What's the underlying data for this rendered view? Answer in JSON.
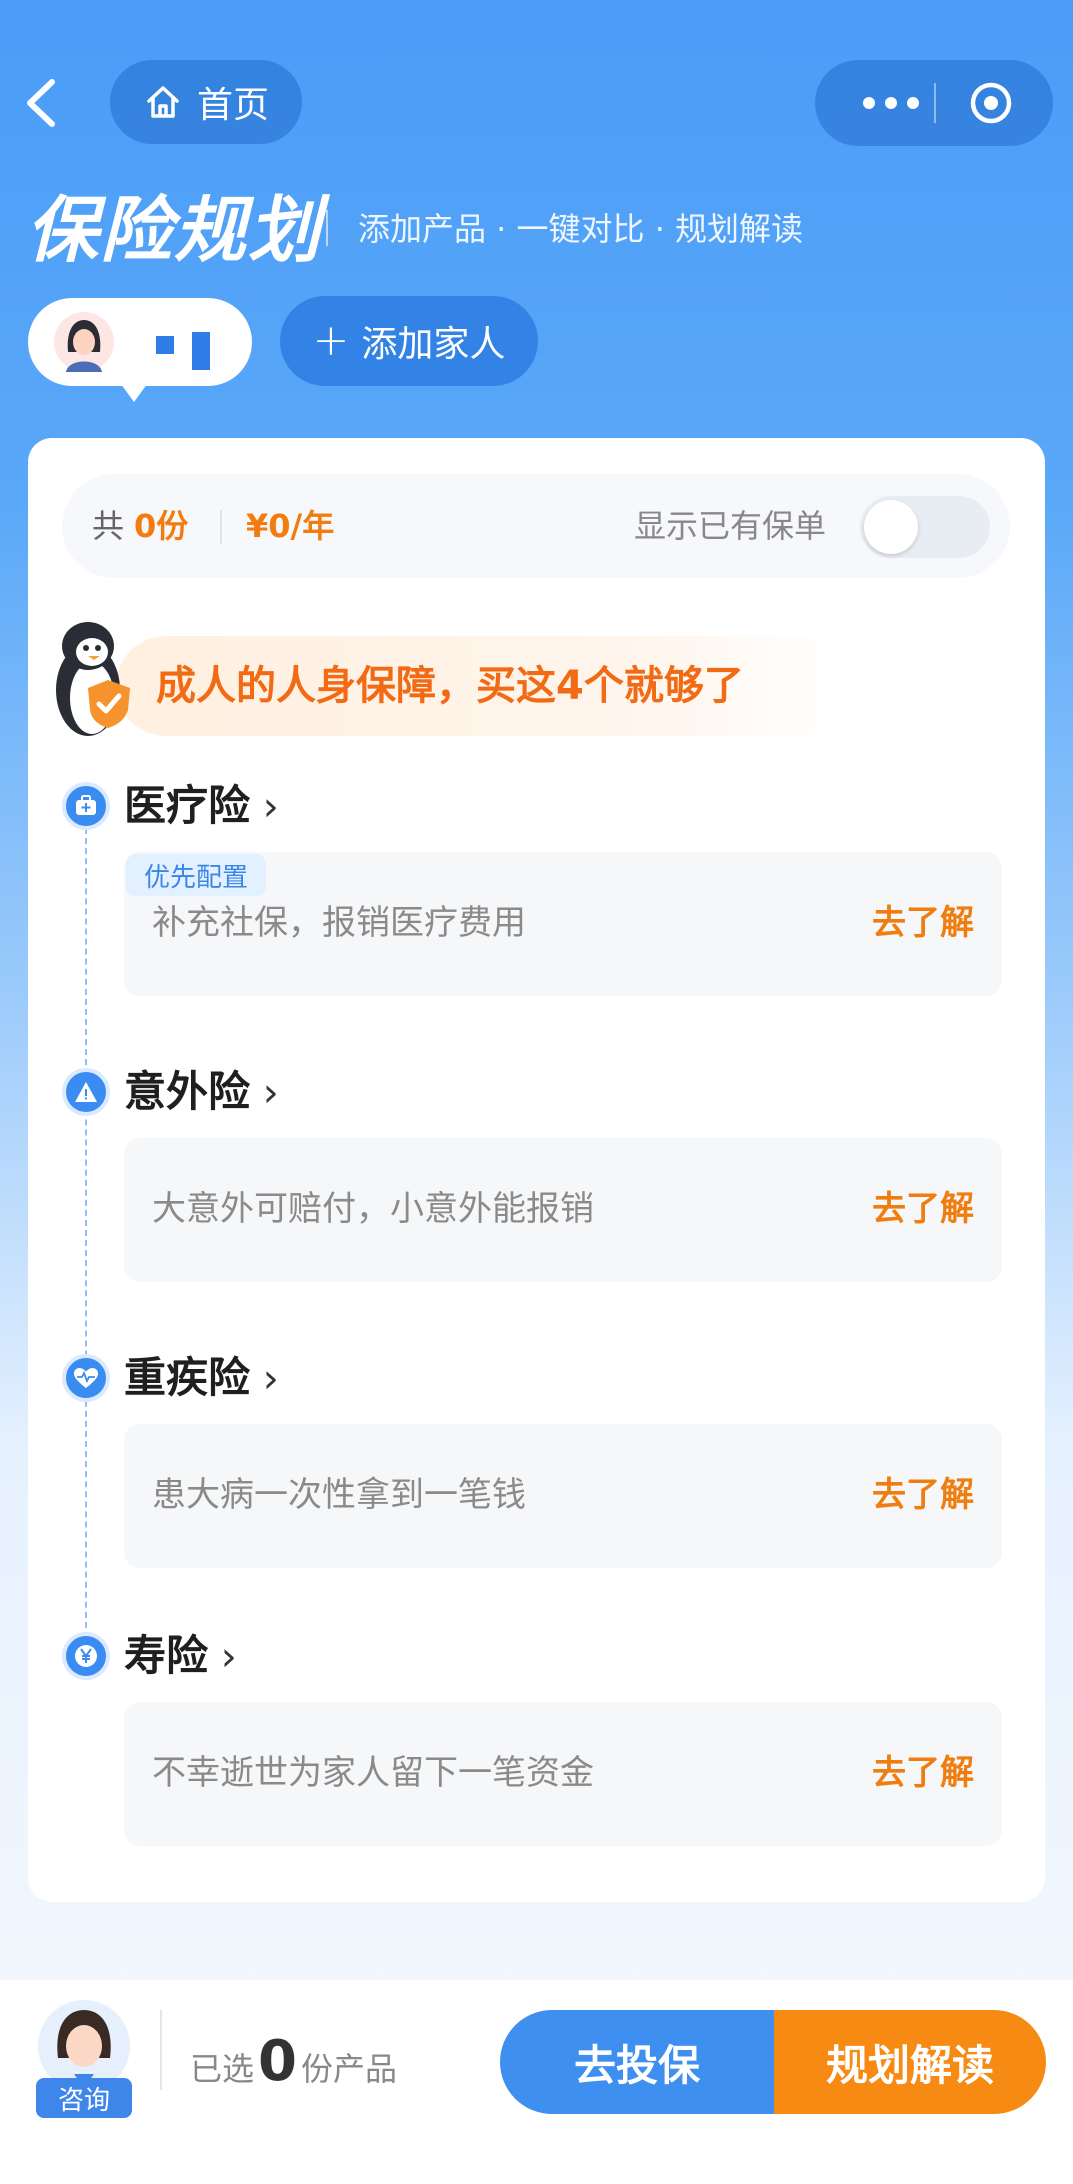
{
  "nav": {
    "home_label": "首页",
    "back_icon": "back-arrow-icon",
    "more_icon": "more-dots-icon",
    "close_icon": "target-close-icon"
  },
  "header": {
    "title": "保险规划",
    "subtitle": "添加产品 · 一键对比 · 规划解读"
  },
  "family": {
    "add_label": "添加家人"
  },
  "summary": {
    "total_prefix": "共",
    "count": "0份",
    "price": "¥0/年",
    "show_existing_label": "显示已有保单",
    "show_existing_on": false
  },
  "banner": {
    "text": "成人的人身保障，买这4个就够了"
  },
  "sections": [
    {
      "title": "医疗险",
      "badge": "优先配置",
      "desc": "补充社保，报销医疗费用",
      "action": "去了解",
      "icon": "medical-kit-icon"
    },
    {
      "title": "意外险",
      "desc": "大意外可赔付，小意外能报销",
      "action": "去了解",
      "icon": "warning-icon"
    },
    {
      "title": "重疾险",
      "desc": "患大病一次性拿到一笔钱",
      "action": "去了解",
      "icon": "heart-pulse-icon"
    },
    {
      "title": "寿险",
      "desc": "不幸逝世为家人留下一笔资金",
      "action": "去了解",
      "icon": "yen-icon"
    }
  ],
  "bottom": {
    "consult_label": "咨询",
    "selected_prefix": "已选",
    "selected_count": "0",
    "selected_suffix": "份产品",
    "insure_label": "去投保",
    "plan_label": "规划解读"
  },
  "colors": {
    "accent_blue": "#3e8ff0",
    "accent_orange": "#f78a12"
  }
}
